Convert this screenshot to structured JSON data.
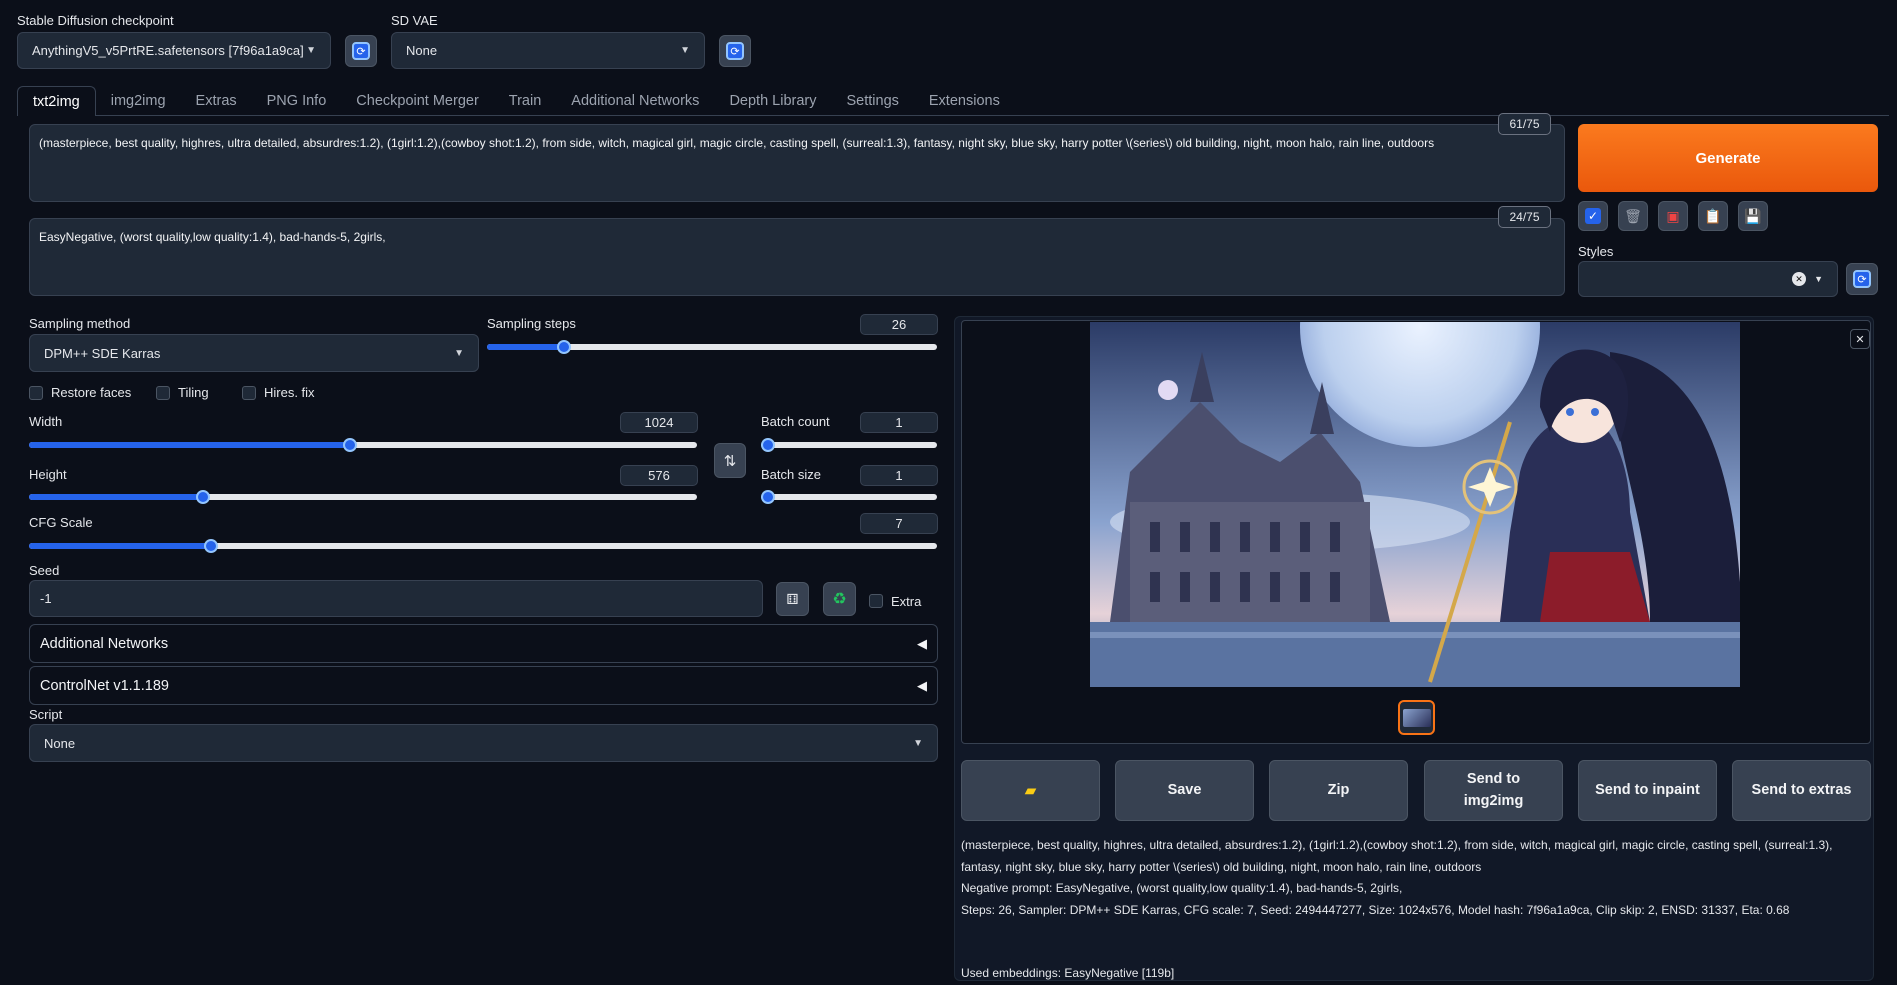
{
  "checkpoint": {
    "label": "Stable Diffusion checkpoint",
    "value": "AnythingV5_v5PrtRE.safetensors [7f96a1a9ca]"
  },
  "vae": {
    "label": "SD VAE",
    "value": "None"
  },
  "tabs": [
    "txt2img",
    "img2img",
    "Extras",
    "PNG Info",
    "Checkpoint Merger",
    "Train",
    "Additional Networks",
    "Depth Library",
    "Settings",
    "Extensions"
  ],
  "prompt": {
    "text": "(masterpiece, best quality,  highres,  ultra detailed, absurdres:1.2), (1girl:1.2),(cowboy shot:1.2), from side, witch,  magical girl,  magic circle,  casting spell, (surreal:1.3), fantasy, night sky, blue sky, harry potter \\(series\\) old building, night, moon halo, rain line,  outdoors",
    "counter": "61/75"
  },
  "negative_prompt": {
    "text": "EasyNegative, (worst quality,low quality:1.4), bad-hands-5, 2girls,",
    "counter": "24/75"
  },
  "generate_label": "Generate",
  "styles_label": "Styles",
  "sampling": {
    "method_label": "Sampling method",
    "method": "DPM++ SDE Karras",
    "steps_label": "Sampling steps",
    "steps": "26",
    "steps_fraction": 0.17
  },
  "checkboxes": {
    "restore_faces": "Restore faces",
    "tiling": "Tiling",
    "hires_fix": "Hires. fix",
    "extra": "Extra"
  },
  "width": {
    "label": "Width",
    "value": "1024",
    "fraction": 0.48
  },
  "height": {
    "label": "Height",
    "value": "576",
    "fraction": 0.26
  },
  "batch_count": {
    "label": "Batch count",
    "value": "1"
  },
  "batch_size": {
    "label": "Batch size",
    "value": "1"
  },
  "cfg": {
    "label": "CFG Scale",
    "value": "7",
    "fraction": 0.2
  },
  "seed": {
    "label": "Seed",
    "value": "-1"
  },
  "accordions": {
    "additional_networks": "Additional Networks",
    "controlnet": "ControlNet v1.1.189"
  },
  "script": {
    "label": "Script",
    "value": "None"
  },
  "output_buttons": {
    "folder_icon": "folder-icon",
    "save": "Save",
    "zip": "Zip",
    "send_img2img_1": "Send to",
    "send_img2img_2": "img2img",
    "send_inpaint": "Send to inpaint",
    "send_extras": "Send to extras"
  },
  "generation_info": {
    "line1": "(masterpiece, best quality, highres, ultra detailed, absurdres:1.2), (1girl:1.2),(cowboy shot:1.2), from side, witch, magical girl, magic circle, casting spell, (surreal:1.3),",
    "line2": "fantasy, night sky, blue sky, harry potter \\(series\\) old building, night, moon halo, rain line, outdoors",
    "line3": "Negative prompt: EasyNegative, (worst quality,low quality:1.4), bad-hands-5, 2girls,",
    "line4": "Steps: 26, Sampler: DPM++ SDE Karras, CFG scale: 7, Seed: 2494447277, Size: 1024x576, Model hash: 7f96a1a9ca, Clip skip: 2, ENSD: 31337, Eta: 0.68",
    "embeddings": "Used embeddings: EasyNegative [119b]"
  },
  "colors": {
    "background": "#0b0f19",
    "panel": "#1f2937",
    "accent": "#2563eb",
    "generate": "#f97316"
  }
}
